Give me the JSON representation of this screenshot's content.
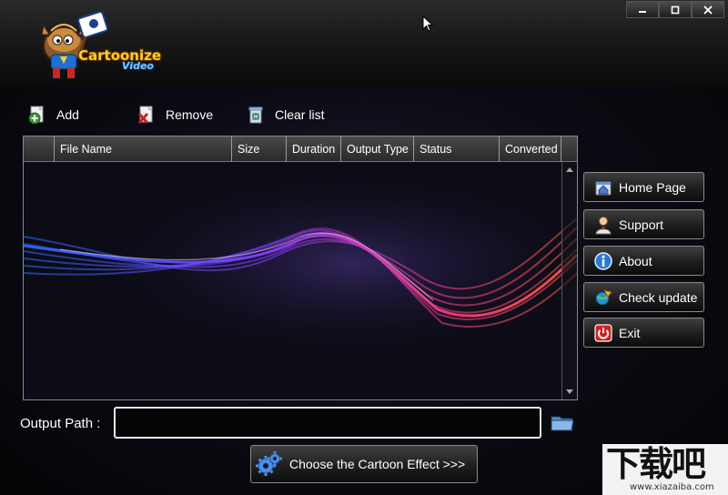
{
  "app": {
    "logo_text_1": "Cartoonize",
    "logo_text_2": "Video"
  },
  "window_controls": [
    "minimize-icon",
    "maximize-icon",
    "close-icon"
  ],
  "toolbar": {
    "add_label": "Add",
    "remove_label": "Remove",
    "clear_label": "Clear list"
  },
  "grid": {
    "columns": [
      "",
      "File Name",
      "Size",
      "Duration",
      "Output Type",
      "Status",
      "Converted"
    ],
    "rows": []
  },
  "sidebar": {
    "items": [
      {
        "label": "Home Page",
        "icon": "home-page-icon"
      },
      {
        "label": "Support",
        "icon": "support-person-icon"
      },
      {
        "label": "About",
        "icon": "info-icon"
      },
      {
        "label": "Check update",
        "icon": "update-globe-icon"
      },
      {
        "label": "Exit",
        "icon": "power-icon"
      }
    ]
  },
  "output": {
    "label": "Output Path :",
    "value": ""
  },
  "effect_button": {
    "label": "Choose the Cartoon Effect >>>"
  },
  "watermark": {
    "big": "下载吧",
    "small": "www.xiazaiba.com"
  },
  "colors": {
    "accent_blue": "#3a7bff",
    "accent_pink": "#ff3c8c",
    "accent_purple": "#8a3cff"
  }
}
